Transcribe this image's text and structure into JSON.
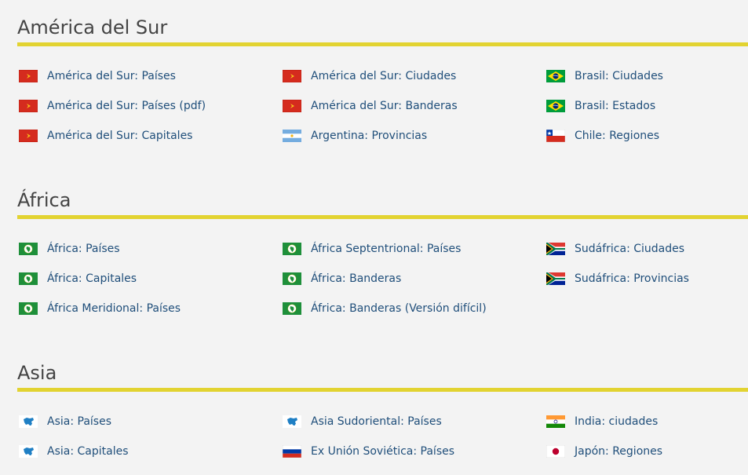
{
  "sections": [
    {
      "title": "América del Sur",
      "items": [
        {
          "label": "América del Sur: Países",
          "flag": "south-america-flag"
        },
        {
          "label": "América del Sur: Países (pdf)",
          "flag": "south-america-flag"
        },
        {
          "label": "América del Sur: Capitales",
          "flag": "south-america-flag"
        },
        {
          "label": "América del Sur: Ciudades",
          "flag": "south-america-flag"
        },
        {
          "label": "América del Sur: Banderas",
          "flag": "south-america-flag"
        },
        {
          "label": "Argentina: Provincias",
          "flag": "argentina-flag"
        },
        {
          "label": "Brasil: Ciudades",
          "flag": "brazil-flag"
        },
        {
          "label": "Brasil: Estados",
          "flag": "brazil-flag"
        },
        {
          "label": "Chile: Regiones",
          "flag": "chile-flag"
        }
      ]
    },
    {
      "title": "África",
      "items": [
        {
          "label": "África: Países",
          "flag": "african-union-flag"
        },
        {
          "label": "África: Capitales",
          "flag": "african-union-flag"
        },
        {
          "label": "África Meridional: Países",
          "flag": "african-union-flag"
        },
        {
          "label": "África Septentrional: Países",
          "flag": "african-union-flag"
        },
        {
          "label": "África: Banderas",
          "flag": "african-union-flag"
        },
        {
          "label": "África: Banderas (Versión difícil)",
          "flag": "african-union-flag"
        },
        {
          "label": "Sudáfrica: Ciudades",
          "flag": "south-africa-flag"
        },
        {
          "label": "Sudáfrica: Provincias",
          "flag": "south-africa-flag"
        }
      ]
    },
    {
      "title": "Asia",
      "items": [
        {
          "label": "Asia: Países",
          "flag": "asia-flag"
        },
        {
          "label": "Asia: Capitales",
          "flag": "asia-flag"
        },
        {
          "label": "Asia Sudoriental: Países",
          "flag": "asia-flag"
        },
        {
          "label": "Ex Unión Soviética: Países",
          "flag": "russia-flag"
        },
        {
          "label": "India: ciudades",
          "flag": "india-flag"
        },
        {
          "label": "Japón: Regiones",
          "flag": "japan-flag"
        }
      ]
    }
  ],
  "colors": {
    "rule": "#e2d331",
    "link": "#1f4e7a",
    "heading": "#444444",
    "background": "#f3f3f3"
  }
}
